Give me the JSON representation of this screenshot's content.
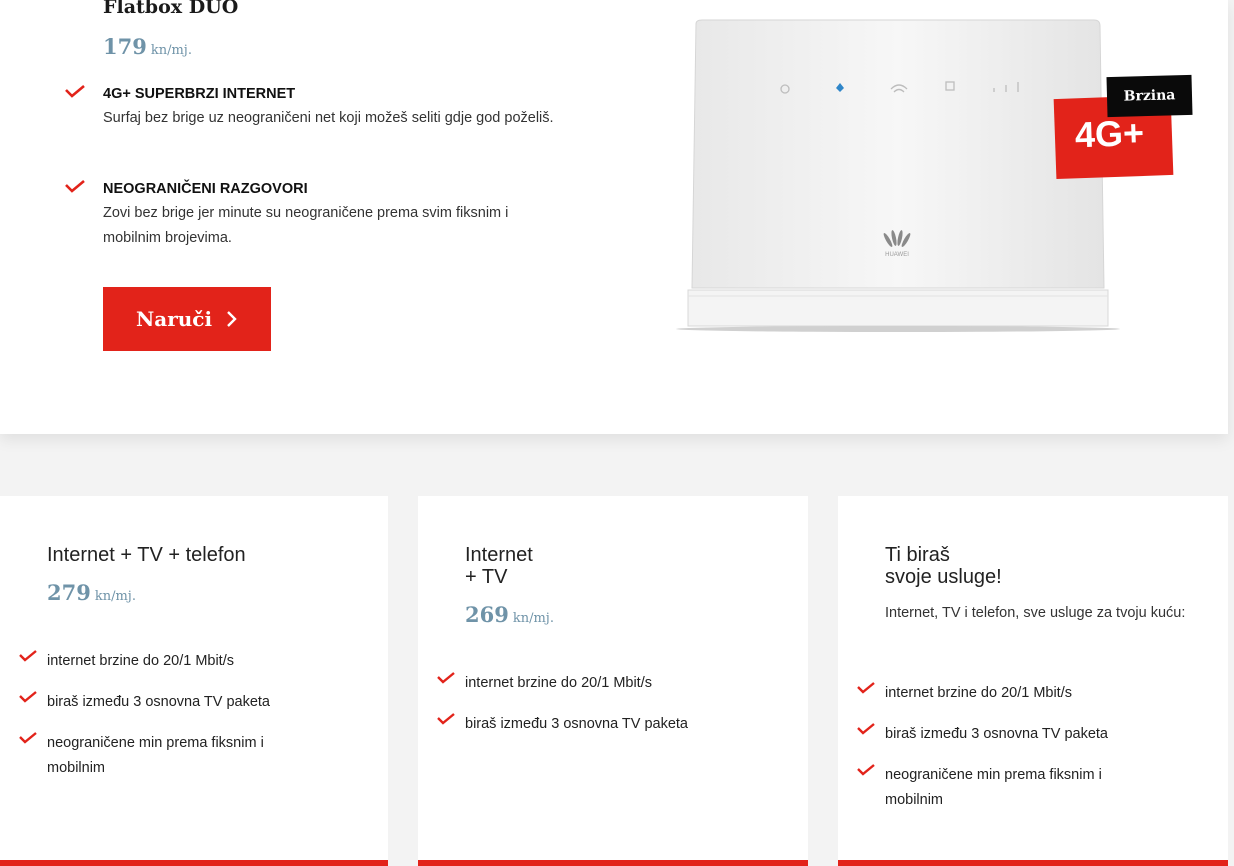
{
  "hero": {
    "title": "Flatbox DUO",
    "price": "179",
    "price_unit": "kn/mj.",
    "features": [
      {
        "title": "4G+ SUPERBRZI INTERNET",
        "desc": "Surfaj bez brige uz neograničeni net koji možeš seliti gdje god poželiš."
      },
      {
        "title": "NEOGRANIČENI RAZGOVORI",
        "desc": "Zovi bez brige jer minute su neograničene prema svim fiksnim i mobilnim brojevima."
      }
    ],
    "order_label": "Naruči",
    "badge_speed_label": "Brzina",
    "badge_speed_value": "4G+",
    "router_brand": "HUAWEI"
  },
  "cards": [
    {
      "title": "Internet + TV + telefon",
      "price": "279",
      "price_unit": "kn/mj.",
      "items": [
        "internet brzine do 20/1 Mbit/s",
        "biraš između 3 osnovna TV paketa",
        "neograničene min prema fiksnim i mobilnim"
      ]
    },
    {
      "title_line1": "Internet",
      "title_line2": "+ TV",
      "price": "269",
      "price_unit": "kn/mj.",
      "items": [
        "internet brzine do 20/1 Mbit/s",
        "biraš između 3 osnovna TV paketa"
      ]
    },
    {
      "title_line1": "Ti biraš",
      "title_line2": "svoje usluge!",
      "desc": "Internet, TV i telefon, sve usluge za tvoju kuću:",
      "items": [
        "internet brzine do 20/1 Mbit/s",
        "biraš između 3 osnovna TV paketa",
        "neograničene min prema fiksnim i mobilnim"
      ]
    }
  ],
  "colors": {
    "accent": "#e2231a",
    "price": "#6f93a8",
    "background": "#f3f3f3"
  }
}
